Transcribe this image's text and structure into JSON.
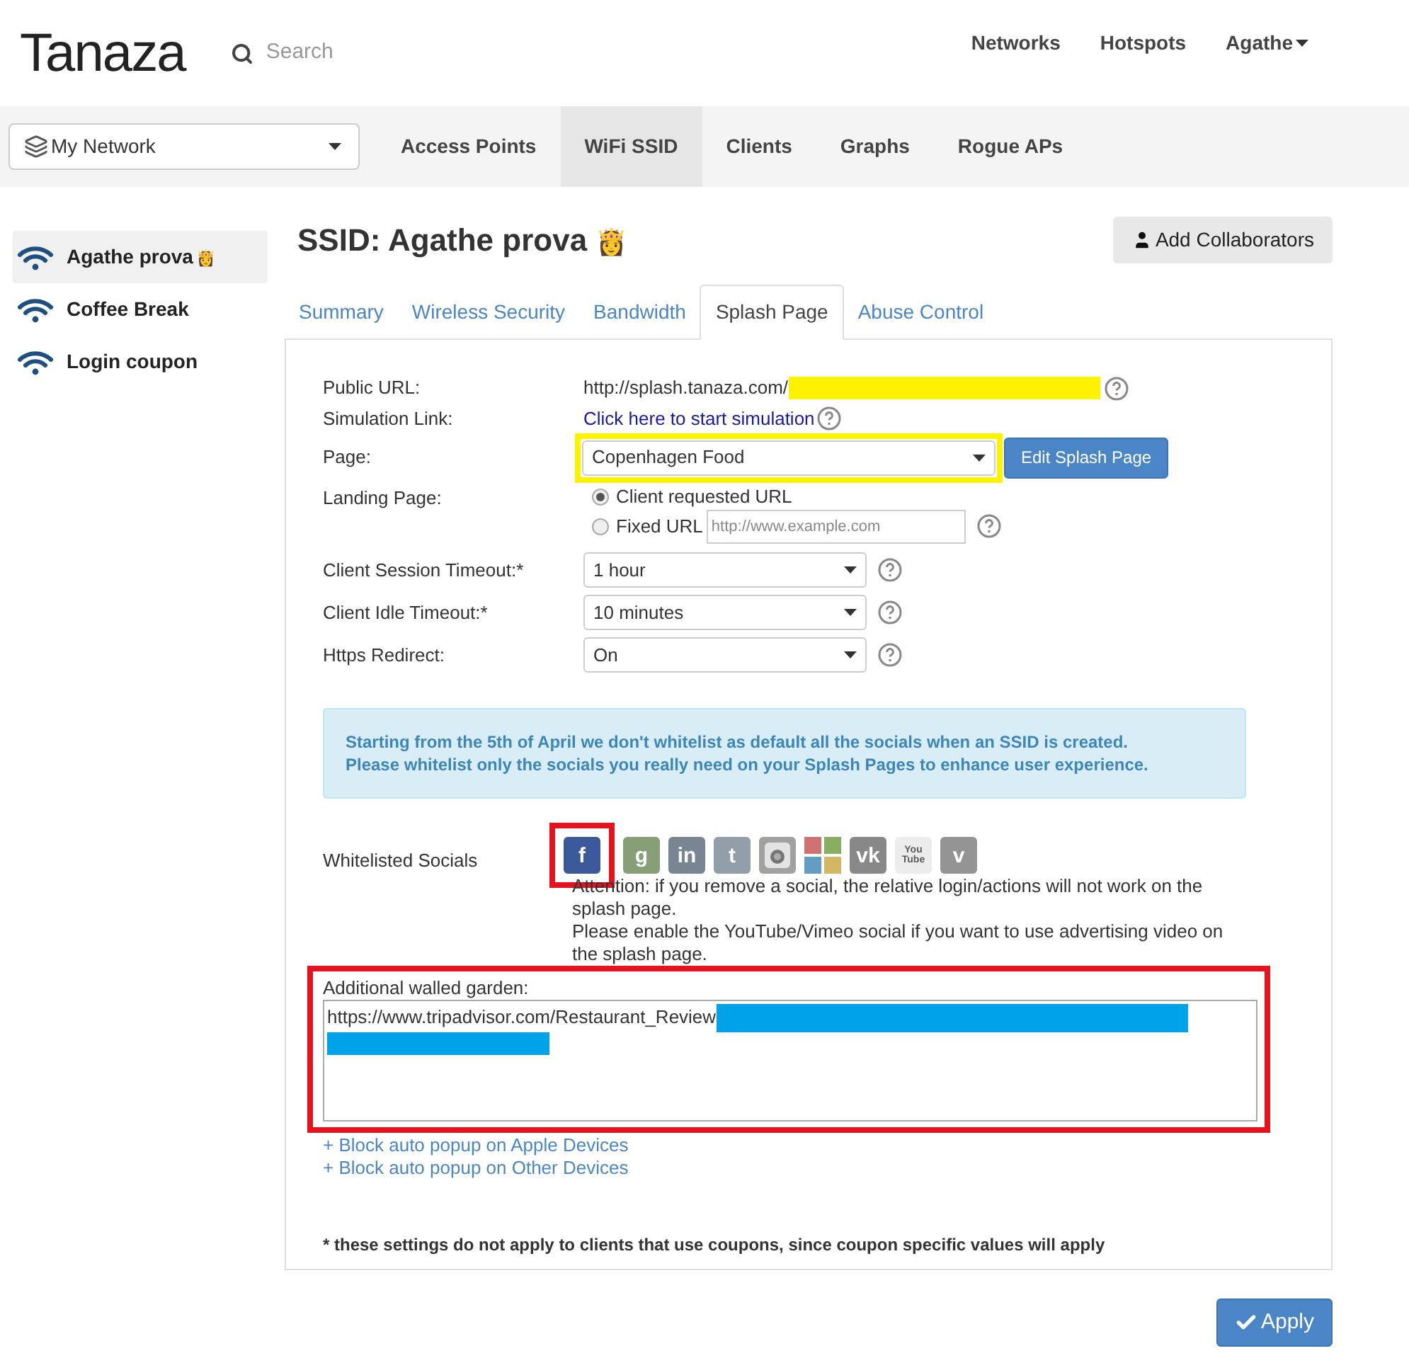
{
  "header": {
    "logo": "Tanaza",
    "search": {
      "placeholder": "Search"
    },
    "links": [
      {
        "label": "Networks",
        "dropdown": false
      },
      {
        "label": "Hotspots",
        "dropdown": false
      },
      {
        "label": "Agathe",
        "dropdown": true
      }
    ]
  },
  "network_select": {
    "value": "My Network"
  },
  "nav_tabs": [
    {
      "label": "Access Points",
      "selected": false
    },
    {
      "label": "WiFi SSID",
      "selected": true
    },
    {
      "label": "Clients",
      "selected": false
    },
    {
      "label": "Graphs",
      "selected": false
    },
    {
      "label": "Rogue APs",
      "selected": false
    }
  ],
  "sidebar": {
    "items": [
      {
        "label": "Agathe prova",
        "badge": "👸",
        "selected": true
      },
      {
        "label": "Coffee Break",
        "selected": false
      },
      {
        "label": "Login coupon",
        "selected": false
      }
    ]
  },
  "title": "SSID: Agathe prova",
  "title_badge": "👸",
  "add_button": "Add Collaborators",
  "tabs": [
    {
      "label": "Summary",
      "selected": false
    },
    {
      "label": "Wireless Security",
      "selected": false
    },
    {
      "label": "Bandwidth",
      "selected": false
    },
    {
      "label": "Splash Page",
      "selected": true
    },
    {
      "label": "Abuse Control",
      "selected": false
    }
  ],
  "public_url": {
    "label": "Public URL:",
    "value": "http://splash.tanaza.com/"
  },
  "simulation": {
    "label": "Simulation Link:",
    "link": "Click here to start simulation"
  },
  "page": {
    "label": "Page:",
    "value": "Copenhagen Food",
    "button": "Edit Splash Page"
  },
  "landing": {
    "label": "Landing Page:",
    "options": [
      {
        "label": "Client requested URL",
        "selected": true
      },
      {
        "label": "Fixed URL",
        "selected": false
      }
    ],
    "placeholder": "http://www.example.com"
  },
  "selects": [
    {
      "label": "Client Session Timeout:*",
      "value": "1 hour"
    },
    {
      "label": "Client Idle Timeout:*",
      "value": "10 minutes"
    },
    {
      "label": "Https Redirect:",
      "value": "On"
    }
  ],
  "notice": [
    "Starting from the 5th of April we don't whitelist as default all the socials when an SSID is created.",
    "Please whitelist only the socials you really need on your Splash Pages to enhance user experience."
  ],
  "socials": {
    "label": "Whitelisted Socials",
    "items": [
      {
        "kind": "letter",
        "glyph": "f",
        "selected": true
      },
      {
        "kind": "letter",
        "glyph": "g",
        "selected": false
      },
      {
        "kind": "letter",
        "glyph": "in",
        "selected": false
      },
      {
        "kind": "letter",
        "glyph": "t",
        "selected": false
      },
      {
        "kind": "camera",
        "selected": false
      },
      {
        "kind": "tiles",
        "selected": false
      },
      {
        "kind": "letter",
        "glyph": "vk",
        "selected": false
      },
      {
        "kind": "letter",
        "glyph": "You Tube",
        "selected": false
      },
      {
        "kind": "letter",
        "glyph": "v",
        "selected": false
      }
    ],
    "notes": [
      "Attention: if you remove a social, the relative login/actions will not work on the splash page.",
      "Please enable the YouTube/Vimeo social if you want to use advertising video on the splash page."
    ]
  },
  "walled_garden": {
    "label": "Additional walled garden:",
    "value": "https://www.tripadvisor.com/Restaurant_Review"
  },
  "links": [
    "+ Block auto popup on Apple Devices",
    "+ Block auto popup on Other Devices"
  ],
  "footnote": "* these settings do not apply to clients that use coupons, since coupon specific values will apply",
  "apply_button": "Apply"
}
